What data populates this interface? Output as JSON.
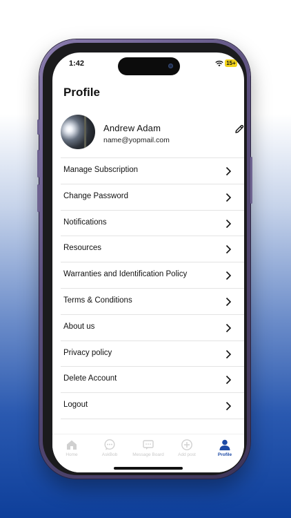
{
  "status_bar": {
    "time": "1:42",
    "battery": "15+"
  },
  "page": {
    "title": "Profile"
  },
  "user": {
    "name": "Andrew Adam",
    "email": "name@yopmail.com"
  },
  "menu": {
    "items": [
      {
        "label": "Manage Subscription"
      },
      {
        "label": "Change Password"
      },
      {
        "label": "Notifications"
      },
      {
        "label": "Resources"
      },
      {
        "label": "Warranties and Identification Policy"
      },
      {
        "label": "Terms & Conditions"
      },
      {
        "label": "About us"
      },
      {
        "label": "Privacy policy"
      },
      {
        "label": "Delete Account"
      },
      {
        "label": "Logout"
      }
    ]
  },
  "tabbar": {
    "items": [
      {
        "label": "Home",
        "icon": "home-icon"
      },
      {
        "label": "AskBob",
        "icon": "chat-bubble-icon"
      },
      {
        "label": "Message Board",
        "icon": "message-board-icon"
      },
      {
        "label": "Add post",
        "icon": "plus-circle-icon"
      },
      {
        "label": "Profile",
        "icon": "person-icon",
        "active": true
      }
    ]
  },
  "colors": {
    "accent": "#1d4aa5",
    "inactive_tab": "#c9c9c9",
    "battery": "#f2d31b"
  }
}
